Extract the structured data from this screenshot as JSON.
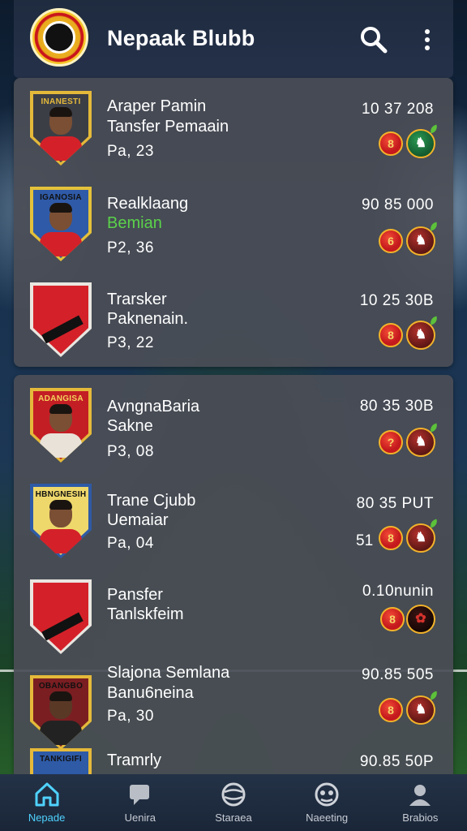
{
  "app_bar": {
    "title": "Nepaak Blubb",
    "logo_icon": "club-logo-icon",
    "search_icon": "search-icon",
    "more_icon": "more-vertical-icon"
  },
  "colors": {
    "app_bar": "#243149",
    "card": "#4a4e56",
    "badge_red": "#c4191d",
    "badge_gold": "#f2b32a",
    "active_nav": "#4fd2ff",
    "highlight_green": "#5bd24a"
  },
  "players": [
    {
      "crest_label": "INANESTI",
      "name": "Araper Pamin",
      "sub": "Tansfer Pemaain",
      "meta": "Pa, 23",
      "price": "10 37 208",
      "badge_text": "8",
      "badge2_style": "green"
    },
    {
      "crest_label": "IGANOSIA",
      "name": "Realklaang",
      "sub": "Bemian",
      "meta": "P2, 36",
      "price": "90 85 000",
      "badge_text": "6",
      "badge2_style": "red"
    },
    {
      "crest_label": "",
      "name": "Trarsker",
      "sub": "Paknenain.",
      "meta": "P3, 22",
      "price": "10 25 30B",
      "badge_text": "8",
      "badge2_style": "red"
    },
    {
      "crest_label": "ADANGISA",
      "name": "AvngnaBaria",
      "sub": "Sakne",
      "meta": "P3, 08",
      "price": "80 35 30B",
      "badge_text": "?",
      "badge2_style": "red"
    },
    {
      "crest_label": "HBNGNESIH",
      "name": "Trane Cjubb",
      "sub": "Uemaiar",
      "meta": "Pa, 04",
      "price": "80 35 PUT",
      "extra": "51",
      "badge_text": "8",
      "badge2_style": "red"
    },
    {
      "crest_label": "",
      "name": "Pansfer",
      "sub": "Tanlskfeim",
      "meta": "",
      "price": "0.10nunin",
      "badge_text": "8",
      "badge2_style": "dark"
    },
    {
      "crest_label": "OBANGBO",
      "name": "Slajona Semlana",
      "sub": "Banu6neina",
      "meta": "Pa, 30",
      "price": "90.85 505",
      "badge_text": "8",
      "badge2_style": "red"
    },
    {
      "crest_label": "TANKIGIFI",
      "name": "Tramrly",
      "sub": "",
      "meta": "",
      "price": "90.85 50P",
      "badge_text": "",
      "badge2_style": ""
    }
  ],
  "bottom_nav": [
    {
      "label": "Nepade",
      "icon": "home-icon",
      "active": true
    },
    {
      "label": "Uenira",
      "icon": "chat-icon",
      "active": false
    },
    {
      "label": "Staraea",
      "icon": "ball-icon",
      "active": false
    },
    {
      "label": "Naeeting",
      "icon": "transfer-icon",
      "active": false
    },
    {
      "label": "Brabios",
      "icon": "profile-icon",
      "active": false
    }
  ]
}
